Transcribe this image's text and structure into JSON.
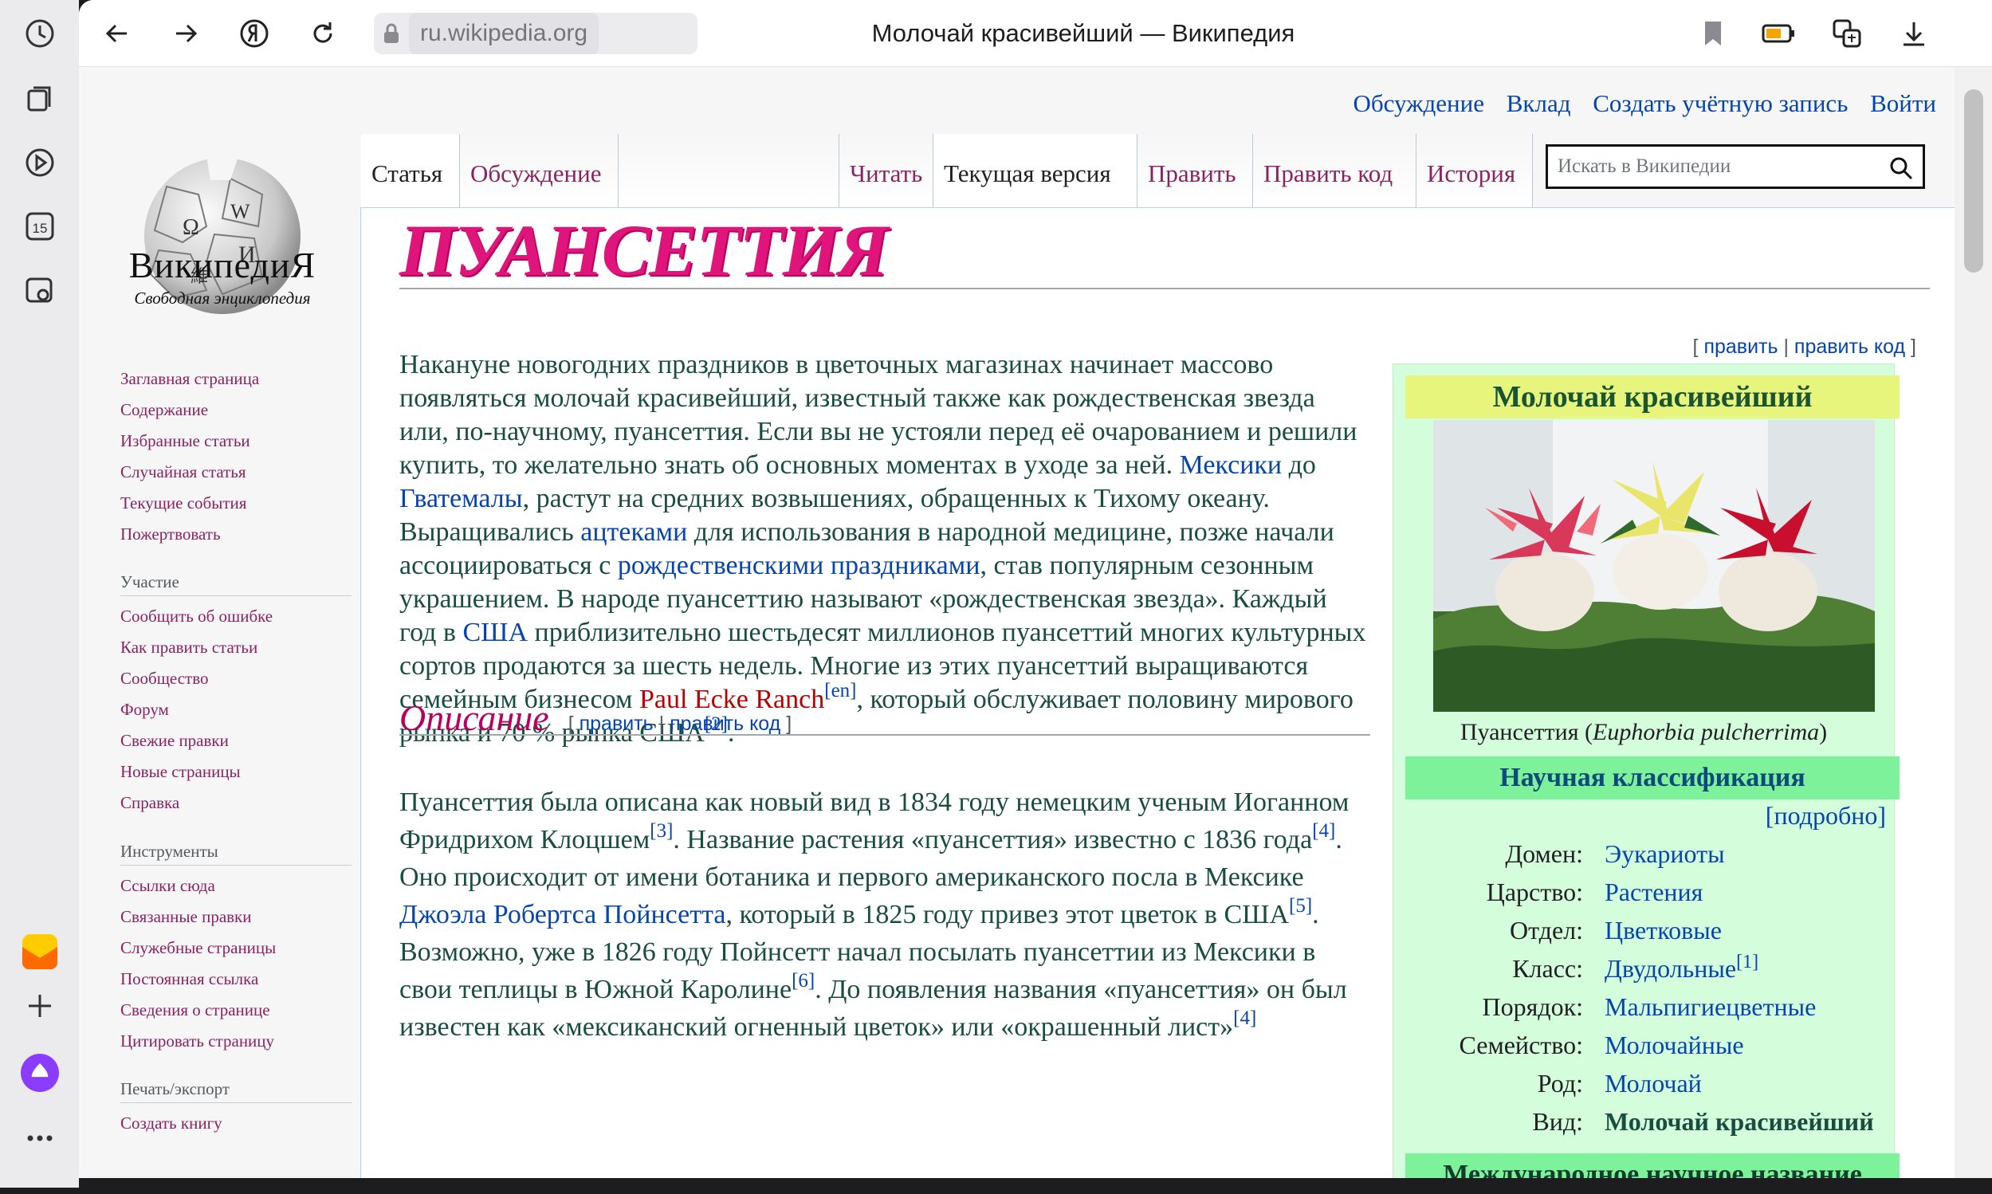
{
  "browser": {
    "url_domain": "ru.wikipedia.org",
    "page_title": "Молочай красивейший — Википедия",
    "sidebar_badge": "15"
  },
  "wiki": {
    "wordmark": "ВикипедиЯ",
    "tagline": "Свободная энциклопедия",
    "nav_main": [
      "Заглавная страница",
      "Содержание",
      "Избранные статьи",
      "Случайная статья",
      "Текущие события",
      "Пожертвовать"
    ],
    "nav_part_head": "Участие",
    "nav_part": [
      "Сообщить об ошибке",
      "Как править статьи",
      "Сообщество",
      "Форум",
      "Свежие правки",
      "Новые страницы",
      "Справка"
    ],
    "nav_tools_head": "Инструменты",
    "nav_tools": [
      "Ссылки сюда",
      "Связанные правки",
      "Служебные страницы",
      "Постоянная ссылка",
      "Сведения о странице",
      "Цитировать страницу"
    ],
    "nav_print_head": "Печать/экспорт",
    "nav_print": [
      "Создать книгу"
    ],
    "toplinks": [
      "Обсуждение",
      "Вклад",
      "Создать учётную запись",
      "Войти"
    ],
    "tabs_left": [
      "Статья",
      "Обсуждение"
    ],
    "tabs_right": [
      "Читать",
      "Текущая версия",
      "Править",
      "Править код",
      "История"
    ],
    "search_placeholder": "Искать в Википедии"
  },
  "article": {
    "title": "ПУАНСЕТТИЯ",
    "edit": "править",
    "edit_code": "править код",
    "p1": {
      "t1": "Накануне новогодних праздников в цветочных магазинах начинает массово появляться молочай красивейший, известный также как рождественская звезда или, по-научному, пуансеттия. Если вы не устояли перед её очарованием и решили купить, то желательно знать об основных моментах в уходе за ней. ",
      "l1": "Мексики",
      "t2": " до ",
      "l2": "Гватемалы",
      "t3": ", растут на средних возвышениях, обращенных к Тихому океану. Выращивались ",
      "l3": "ацтеками",
      "t4": " для использования в народной медицине, позже начали ассоциироваться с ",
      "l4": "рождественскими праздниками",
      "t5": ", став популярным сезонным украшением. В народе пуансеттию называют «рождественская звезда». Каждый год в ",
      "l5": "США",
      "t6": " приблизительно шестьдесят миллионов пуансеттий многих культурных сортов продаются за шесть недель. Многие из этих пуансеттий выращиваются семейным бизнесом ",
      "l6": "Paul Ecke Ranch",
      "s1": "[en]",
      "t7": ", который обслуживает половину мирового рынка и 70 % рынка США",
      "s2": "[2]",
      "t8": "."
    },
    "h2": "Описание",
    "p2": {
      "t1": "Пуансеттия была описана как новый вид в 1834 году немецким ученым Иоганном Фридрихом Клоцшем",
      "s1": "[3]",
      "t2": ". Название растения «пуансеттия» известно с 1836 года",
      "s2": "[4]",
      "t3": ". Оно происходит от имени ботаника и первого американского посла в Мексике ",
      "l1": "Джоэла Робертса Пойнсетта",
      "t4": ", который в 1825 году привез этот цветок в США",
      "s3": "[5]",
      "t5": ". Возможно, уже в 1826 году Пойнсетт начал посылать пуансеттии из Мексики в свои теплицы в Южной Каролине",
      "s4": "[6]",
      "t6": ". До появления названия «пуансеттия» он был известен как «мексиканский огненный цветок» или «окрашенный лист»",
      "s5": "[4]"
    }
  },
  "infobox": {
    "title": "Молочай красивейший",
    "caption_a": "Пуансеттия (",
    "caption_latin": "Euphorbia pulcherrima",
    "caption_b": ")",
    "sec1": "Научная классификация",
    "more": "[подробно]",
    "rows": [
      {
        "k": "Домен:",
        "v": "Эукариоты"
      },
      {
        "k": "Царство:",
        "v": "Растения"
      },
      {
        "k": "Отдел:",
        "v": "Цветковые"
      },
      {
        "k": "Класс:",
        "v": "Двудольные",
        "sup": "[1]"
      },
      {
        "k": "Порядок:",
        "v": "Мальпигиецветные"
      },
      {
        "k": "Семейство:",
        "v": "Молочайные"
      },
      {
        "k": "Род:",
        "v": "Молочай"
      },
      {
        "k": "Вид:",
        "v": "Молочай красивейший"
      }
    ],
    "sec2": "Международное научное название"
  }
}
